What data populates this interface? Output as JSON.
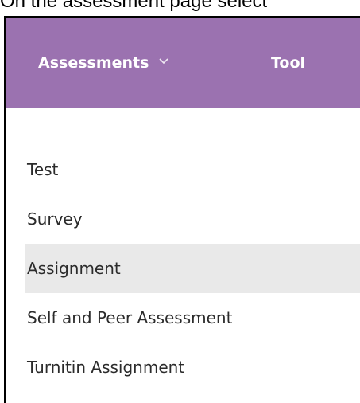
{
  "caption": "On the assessment page select",
  "nav": {
    "assessments_label": "Assessments",
    "tools_label": "Tool",
    "background": "#9b72b0"
  },
  "menu": {
    "items": [
      {
        "label": "Test"
      },
      {
        "label": "Survey"
      },
      {
        "label": "Assignment",
        "highlighted": true
      },
      {
        "label": "Self and Peer Assessment"
      },
      {
        "label": "Turnitin Assignment"
      }
    ]
  },
  "icons": {
    "assessments_dropdown": "chevron-down-icon"
  }
}
